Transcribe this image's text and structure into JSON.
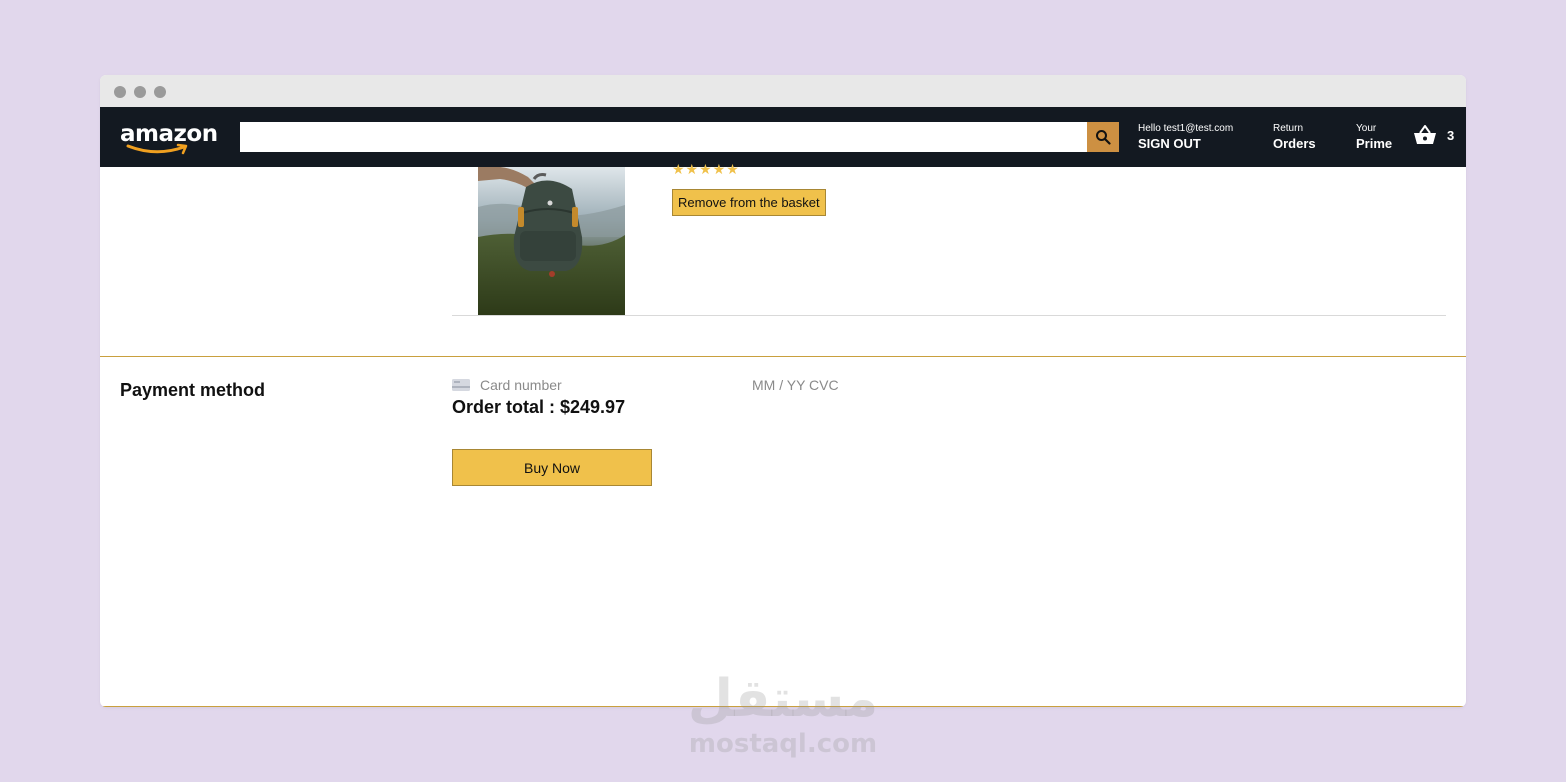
{
  "header": {
    "logo_text": "amazon",
    "search": {
      "value": "",
      "placeholder": ""
    },
    "account": {
      "line_one": "Hello test1@test.com",
      "line_two": "SIGN OUT"
    },
    "returns": {
      "line_one": "Return",
      "line_two": "Orders"
    },
    "prime": {
      "line_one": "Your",
      "line_two": "Prime"
    },
    "basket_count": "3"
  },
  "product": {
    "rating_stars": "★★★★★",
    "remove_label": "Remove from the basket"
  },
  "payment": {
    "title": "Payment method",
    "card_placeholder": "Card number",
    "expiry_cvc_placeholder": "MM / YY  CVC",
    "order_total": "Order total : $249.97",
    "buy_label": "Buy Now"
  },
  "watermark": {
    "arabic": "مستقل",
    "latin": "mostaql.com"
  },
  "colors": {
    "page_background": "#e1d7ec",
    "header_background": "#131921",
    "search_button": "#cd9042",
    "button_yellow": "#f0c14b",
    "divider_gold": "#c9a03e"
  }
}
